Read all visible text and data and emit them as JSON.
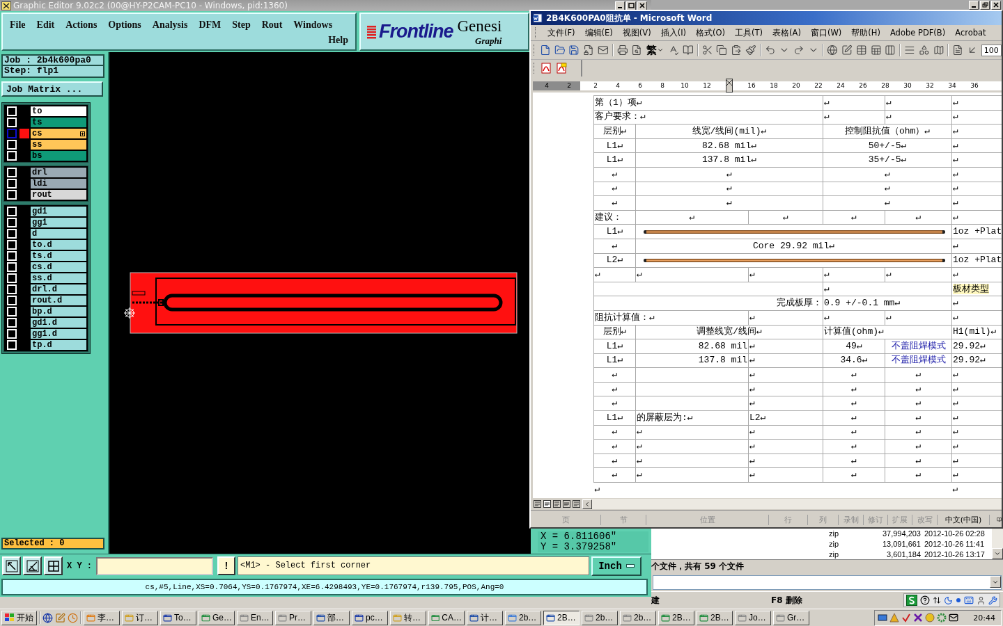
{
  "genesis": {
    "title": "Graphic Editor 9.02c2 (00@HY-P2CAM-PC10 - Windows, pid:1360)",
    "menus": [
      "File",
      "Edit",
      "Actions",
      "Options",
      "Analysis",
      "DFM",
      "Step",
      "Rout",
      "Windows"
    ],
    "help": "Help",
    "logo": {
      "brand": "Frontline",
      "product": "Genesi",
      "tagline": "Graphi"
    },
    "job": "Job : 2b4k600pa0",
    "step": "Step: flp1",
    "job_matrix": "Job Matrix ...",
    "layer_groups": [
      {
        "layers": [
          {
            "name": "to",
            "color": "#ffffff",
            "checked": false,
            "selected": false
          },
          {
            "name": "ts",
            "color": "#0f9a78",
            "checked": false,
            "selected": false
          },
          {
            "name": "cs",
            "color": "#ffc658",
            "checked": false,
            "selected": true
          },
          {
            "name": "ss",
            "color": "#ffc658",
            "checked": false,
            "selected": false
          },
          {
            "name": "bs",
            "color": "#0f9a78",
            "checked": false,
            "selected": false
          }
        ]
      },
      {
        "layers": [
          {
            "name": "drl",
            "color": "#9aaab4",
            "checked": false,
            "selected": false
          },
          {
            "name": "ldi",
            "color": "#9aaab4",
            "checked": false,
            "selected": false
          },
          {
            "name": "rout",
            "color": "#d8d8d8",
            "checked": false,
            "selected": false
          }
        ]
      },
      {
        "layers": [
          {
            "name": "gd1",
            "color": "#9ddcdc",
            "checked": false,
            "selected": false
          },
          {
            "name": "gg1",
            "color": "#9ddcdc",
            "checked": false,
            "selected": false
          },
          {
            "name": "d",
            "color": "#9ddcdc",
            "checked": false,
            "selected": false
          },
          {
            "name": "to.d",
            "color": "#9ddcdc",
            "checked": false,
            "selected": false
          },
          {
            "name": "ts.d",
            "color": "#9ddcdc",
            "checked": false,
            "selected": false
          },
          {
            "name": "cs.d",
            "color": "#9ddcdc",
            "checked": false,
            "selected": false
          },
          {
            "name": "ss.d",
            "color": "#9ddcdc",
            "checked": false,
            "selected": false
          },
          {
            "name": "drl.d",
            "color": "#9ddcdc",
            "checked": false,
            "selected": false
          },
          {
            "name": "rout.d",
            "color": "#9ddcdc",
            "checked": false,
            "selected": false
          },
          {
            "name": "bp.d",
            "color": "#9ddcdc",
            "checked": false,
            "selected": false
          },
          {
            "name": "gd1.d",
            "color": "#9ddcdc",
            "checked": false,
            "selected": false
          },
          {
            "name": "gg1.d",
            "color": "#9ddcdc",
            "checked": false,
            "selected": false
          },
          {
            "name": "tp.d",
            "color": "#9ddcdc",
            "checked": false,
            "selected": false
          }
        ]
      }
    ],
    "selected_count": "Selected : 0",
    "coords": [
      "X = 6.811606\"",
      "Y = 3.379258\""
    ],
    "xy_label": "X Y :",
    "warn": "!",
    "prompt": "<M1> - Select first corner",
    "units": "Inch",
    "status": "cs,#5,Line,XS=0.7064,YS=0.1767974,XE=6.4298493,YE=0.1767974,r139.795,POS,Ang=0"
  },
  "word": {
    "title": "2B4K600PA0阻抗单 - Microsoft Word",
    "menus": [
      "文件(F)",
      "编辑(E)",
      "视图(V)",
      "插入(I)",
      "格式(O)",
      "工具(T)",
      "表格(A)",
      "窗口(W)",
      "帮助(H)",
      "Adobe PDF(B)",
      "Acrobat"
    ],
    "script_button": "繁",
    "zoom": "100",
    "ruler": [
      {
        "kind": "margin_number",
        "label": "4"
      },
      {
        "kind": "margin_number",
        "label": "2"
      },
      {
        "kind": "number",
        "label": "2"
      },
      {
        "kind": "number",
        "label": "4"
      },
      {
        "kind": "number",
        "label": "6"
      },
      {
        "kind": "number",
        "label": "8"
      },
      {
        "kind": "number",
        "label": "10"
      },
      {
        "kind": "number",
        "label": "12"
      },
      {
        "kind": "marker"
      },
      {
        "kind": "number",
        "label": "16"
      },
      {
        "kind": "number",
        "label": "18"
      },
      {
        "kind": "number",
        "label": "20"
      },
      {
        "kind": "number",
        "label": "22"
      },
      {
        "kind": "number",
        "label": "24"
      },
      {
        "kind": "number",
        "label": "26"
      },
      {
        "kind": "number",
        "label": "28"
      },
      {
        "kind": "number",
        "label": "30"
      },
      {
        "kind": "number",
        "label": "32"
      },
      {
        "kind": "number",
        "label": "34"
      },
      {
        "kind": "number",
        "label": "36"
      }
    ],
    "table": [
      {
        "kind": "caption",
        "cells": [
          {
            "text": "第（1）项↵"
          },
          {
            "text": "↵"
          },
          {
            "text": "↵"
          },
          {
            "text": "↵"
          }
        ]
      },
      {
        "kind": "caption",
        "cells": [
          {
            "text": "客户要求：↵"
          },
          {
            "text": "↵"
          },
          {
            "text": "↵"
          },
          {
            "text": "↵"
          }
        ]
      },
      {
        "kind": "spec",
        "cells": [
          {
            "text": "层别↵"
          },
          {
            "text": "线宽/线间(mil)↵"
          },
          {
            "text": "控制阻抗值（ohm）↵"
          },
          {
            "text": "↵"
          }
        ]
      },
      {
        "kind": "spec",
        "cells": [
          {
            "text": "L1↵"
          },
          {
            "text": "82.68 mil↵"
          },
          {
            "text": "50+/-5↵"
          },
          {
            "text": "↵"
          }
        ]
      },
      {
        "kind": "spec",
        "cells": [
          {
            "text": "L1↵"
          },
          {
            "text": "137.8 mil↵"
          },
          {
            "text": "35+/-5↵"
          },
          {
            "text": "↵"
          }
        ]
      },
      {
        "kind": "spec",
        "cells": [
          {
            "text": "↵"
          },
          {
            "text": "↵"
          },
          {
            "text": "↵"
          },
          {
            "text": "↵"
          }
        ]
      },
      {
        "kind": "spec",
        "cells": [
          {
            "text": "↵"
          },
          {
            "text": "↵"
          },
          {
            "text": "↵"
          },
          {
            "text": "↵"
          }
        ]
      },
      {
        "kind": "spec",
        "cells": [
          {
            "text": "↵"
          },
          {
            "text": "↵"
          },
          {
            "text": "↵"
          },
          {
            "text": "↵"
          }
        ]
      },
      {
        "kind": "suggest",
        "cells": [
          {
            "text": "建议："
          },
          {
            "text": "↵"
          },
          {
            "text": "↵"
          },
          {
            "text": "↵"
          },
          {
            "text": "↵"
          },
          {
            "text": "↵"
          }
        ]
      },
      {
        "kind": "stackup",
        "cells": [
          {
            "text": "L1↵"
          },
          {
            "kind": "copper"
          },
          {
            "text": "1oz +Plat"
          }
        ]
      },
      {
        "kind": "stackup",
        "cells": [
          {
            "text": "↵"
          },
          {
            "text": "Core   29.92 mil↵"
          },
          {
            "text": "↵"
          }
        ]
      },
      {
        "kind": "stackup",
        "cells": [
          {
            "text": "L2↵"
          },
          {
            "kind": "copper"
          },
          {
            "text": "1oz +Plat"
          }
        ]
      },
      {
        "kind": "blank",
        "cells": [
          {
            "text": "↵"
          },
          {
            "text": "↵"
          },
          {
            "text": "↵"
          },
          {
            "text": "↵"
          },
          {
            "text": "↵"
          },
          {
            "text": "↵"
          }
        ]
      },
      {
        "kind": "board",
        "cells": [
          {
            "kind": "empty"
          },
          {
            "text": "↵"
          },
          {
            "text": "板材类型",
            "kind": "highlight"
          }
        ]
      },
      {
        "kind": "board",
        "cells": [
          {
            "text": "完成板厚："
          },
          {
            "text": "0.9 +/-0.1 mm↵"
          },
          {
            "text": "↵"
          }
        ]
      },
      {
        "kind": "calc_caption",
        "cells": [
          {
            "text": "阻抗计算值：↵"
          },
          {
            "text": "↵"
          },
          {
            "text": "↵"
          },
          {
            "text": "↵"
          },
          {
            "text": "↵"
          }
        ]
      },
      {
        "kind": "calc_head",
        "cells": [
          {
            "text": "层别↵"
          },
          {
            "text": "调整线宽/线间↵"
          },
          {
            "text": "计算值(ohm)↵"
          },
          {
            "text": "H1(mil)↵"
          }
        ]
      },
      {
        "kind": "calc",
        "cells": [
          {
            "text": "L1↵"
          },
          {
            "text": "82.68 mil"
          },
          {
            "text": "↵"
          },
          {
            "text": "49↵"
          },
          {
            "text": "不盖阻焊模式",
            "kind": "link"
          },
          {
            "text": "29.92↵"
          }
        ]
      },
      {
        "kind": "calc",
        "cells": [
          {
            "text": "L1↵"
          },
          {
            "text": "137.8 mil"
          },
          {
            "text": "↵"
          },
          {
            "text": "34.6↵"
          },
          {
            "text": "不盖阻焊模式",
            "kind": "link"
          },
          {
            "text": "29.92↵"
          }
        ]
      },
      {
        "kind": "calc",
        "cells": [
          {
            "text": "↵"
          },
          {
            "kind": "empty"
          },
          {
            "text": "↵"
          },
          {
            "text": "↵"
          },
          {
            "text": "↵"
          },
          {
            "text": "↵"
          }
        ]
      },
      {
        "kind": "calc",
        "cells": [
          {
            "text": "↵"
          },
          {
            "kind": "empty"
          },
          {
            "text": "↵"
          },
          {
            "text": "↵"
          },
          {
            "text": "↵"
          },
          {
            "text": "↵"
          }
        ]
      },
      {
        "kind": "calc",
        "cells": [
          {
            "text": "↵"
          },
          {
            "kind": "empty"
          },
          {
            "text": "↵"
          },
          {
            "text": "↵"
          },
          {
            "text": "↵"
          },
          {
            "text": "↵"
          }
        ]
      },
      {
        "kind": "note",
        "cells": [
          {
            "text": "L1↵"
          },
          {
            "text": "的屏蔽层为:↵"
          },
          {
            "text": "L2↵"
          },
          {
            "text": "↵"
          },
          {
            "text": "↵"
          },
          {
            "text": "↵"
          }
        ]
      },
      {
        "kind": "note",
        "cells": [
          {
            "text": "↵"
          },
          {
            "text": "↵"
          },
          {
            "text": "↵"
          },
          {
            "text": "↵"
          },
          {
            "text": "↵"
          },
          {
            "text": "↵"
          }
        ]
      },
      {
        "kind": "note",
        "cells": [
          {
            "text": "↵"
          },
          {
            "text": "↵"
          },
          {
            "text": "↵"
          },
          {
            "text": "↵"
          },
          {
            "text": "↵"
          },
          {
            "text": "↵"
          }
        ]
      },
      {
        "kind": "note",
        "cells": [
          {
            "text": "↵"
          },
          {
            "text": "↵"
          },
          {
            "text": "↵"
          },
          {
            "text": "↵"
          },
          {
            "text": "↵"
          },
          {
            "text": "↵"
          }
        ]
      },
      {
        "kind": "note",
        "cells": [
          {
            "text": "↵"
          },
          {
            "text": "↵"
          },
          {
            "text": "↵"
          },
          {
            "text": "↵"
          },
          {
            "text": "↵"
          },
          {
            "text": "↵"
          }
        ]
      },
      {
        "kind": "paragraph",
        "cells": [
          {
            "text": "↵"
          },
          {
            "text": "↵"
          }
        ]
      }
    ],
    "status": [
      {
        "text": "页",
        "disabled": true
      },
      {
        "text": "节",
        "disabled": true
      },
      {
        "text": "位置",
        "disabled": true
      },
      {
        "text": "行",
        "disabled": true
      },
      {
        "text": "列",
        "disabled": true
      },
      {
        "text": "录制",
        "disabled": true
      },
      {
        "text": "修订",
        "disabled": true
      },
      {
        "text": "扩展",
        "disabled": true
      },
      {
        "text": "改写",
        "disabled": true
      },
      {
        "text": "中文(中国)",
        "disabled": false
      }
    ]
  },
  "explorer": {
    "files": [
      {
        "type": "zip",
        "size": "37,994,203",
        "modified": "2012-10-26 02:28"
      },
      {
        "type": "zip",
        "size": "13,091,661",
        "modified": "2012-10-26 11:41"
      },
      {
        "type": "zip",
        "size": "3,601,184",
        "modified": "2012-10-26 13:17"
      }
    ],
    "summary": "个文件，共有 59 个文件",
    "keys": [
      "建",
      "F8 删除"
    ]
  },
  "taskbar": {
    "start": "开始",
    "tasks": [
      {
        "label": "李…",
        "selected": false
      },
      {
        "label": "订…",
        "selected": false
      },
      {
        "label": "To…",
        "selected": false
      },
      {
        "label": "Ge…",
        "selected": false
      },
      {
        "label": "En…",
        "selected": false
      },
      {
        "label": "Pr…",
        "selected": false
      },
      {
        "label": "部…",
        "selected": false
      },
      {
        "label": "pc…",
        "selected": false
      },
      {
        "label": "转…",
        "selected": false
      },
      {
        "label": "CA…",
        "selected": false
      },
      {
        "label": "计…",
        "selected": false
      },
      {
        "label": "2b…",
        "selected": false
      },
      {
        "label": "2B…",
        "selected": true
      },
      {
        "label": "2b…",
        "selected": false
      },
      {
        "label": "2b…",
        "selected": false
      },
      {
        "label": "2B…",
        "selected": false
      },
      {
        "label": "2B…",
        "selected": false
      },
      {
        "label": "Jo…",
        "selected": false
      },
      {
        "label": "Gr…",
        "selected": false
      }
    ],
    "time": "20:44"
  }
}
